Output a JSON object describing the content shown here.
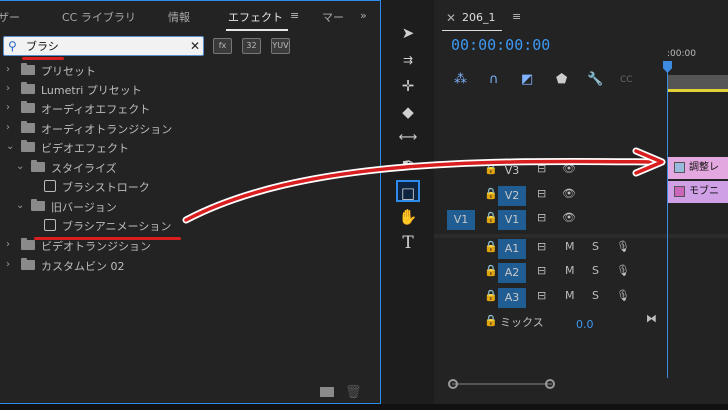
{
  "tabs": [
    {
      "label": "ザー"
    },
    {
      "label": "CC ライブラリ"
    },
    {
      "label": "情報"
    },
    {
      "label": "エフェクト"
    },
    {
      "label": "マー"
    }
  ],
  "tab_menu_icon": "≡",
  "tab_overflow": "»",
  "search": {
    "value": "ブラシ",
    "placeholder": ""
  },
  "filter_buttons": [
    "fx",
    "32",
    "YUV"
  ],
  "effects_tree": [
    {
      "label": "プリセット",
      "level": 0,
      "expanded": false,
      "kind": "folder"
    },
    {
      "label": "Lumetri プリセット",
      "level": 0,
      "expanded": false,
      "kind": "folder-star"
    },
    {
      "label": "オーディオエフェクト",
      "level": 0,
      "expanded": false,
      "kind": "folder"
    },
    {
      "label": "オーディオトランジション",
      "level": 0,
      "expanded": false,
      "kind": "folder"
    },
    {
      "label": "ビデオエフェクト",
      "level": 0,
      "expanded": true,
      "kind": "folder"
    },
    {
      "label": "スタイライズ",
      "level": 1,
      "expanded": true,
      "kind": "folder"
    },
    {
      "label": "ブラシストローク",
      "level": 2,
      "kind": "effect"
    },
    {
      "label": "旧バージョン",
      "level": 1,
      "expanded": true,
      "kind": "folder"
    },
    {
      "label": "ブラシアニメーション",
      "level": 2,
      "kind": "effect"
    },
    {
      "label": "ビデオトランジション",
      "level": 0,
      "expanded": false,
      "kind": "folder"
    },
    {
      "label": "カスタムビン 02",
      "level": 0,
      "expanded": false,
      "kind": "folder"
    }
  ],
  "timeline": {
    "sequence_name": "206_1",
    "timecode": "00:00:00:00",
    "ruler_label": ":00:00",
    "video_tracks": [
      {
        "name": "V3",
        "source": ""
      },
      {
        "name": "V2",
        "source": ""
      },
      {
        "name": "V1",
        "source": "V1"
      }
    ],
    "audio_tracks": [
      {
        "name": "A1",
        "m": "M",
        "s": "S"
      },
      {
        "name": "A2",
        "m": "M",
        "s": "S"
      },
      {
        "name": "A3",
        "m": "M",
        "s": "S"
      }
    ],
    "mix_label": "ミックス",
    "mix_value": "0.0",
    "clips": [
      {
        "label": "調整レ",
        "track": "V3"
      },
      {
        "label": "モブニ",
        "track": "V2"
      }
    ]
  },
  "colors": {
    "accent": "#2d8ceb",
    "timecode": "#3d98f3",
    "clip": "#e4a8e0",
    "annotation": "#d81e1e"
  }
}
